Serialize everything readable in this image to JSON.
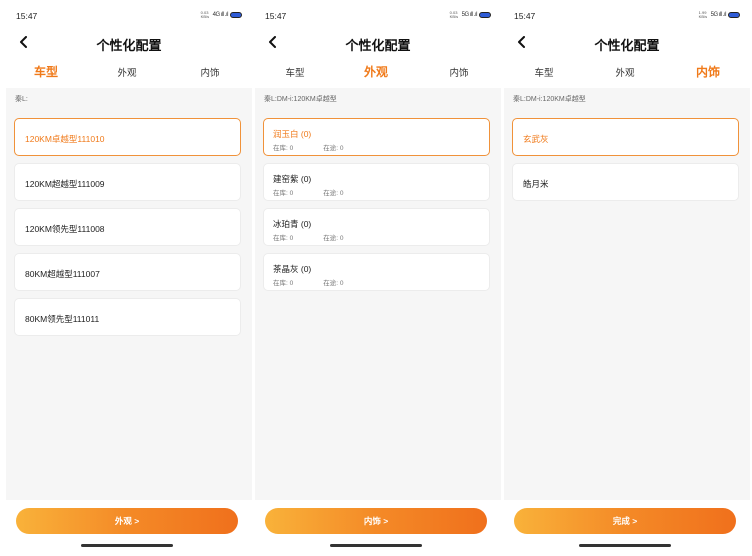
{
  "screens": [
    {
      "status_time": "15:47",
      "net_speed": "0.03 KB/s",
      "signal": "4G ıll .ıl",
      "title": "个性化配置",
      "tabs": [
        "车型",
        "外观",
        "内饰"
      ],
      "active_tab": 0,
      "model_line": "秦L:",
      "items": [
        {
          "label": "120KM卓越型111010",
          "selected": true
        },
        {
          "label": "120KM超越型111009",
          "selected": false
        },
        {
          "label": "120KM领先型111008",
          "selected": false
        },
        {
          "label": "80KM超越型111007",
          "selected": false
        },
        {
          "label": "80KM领先型111011",
          "selected": false
        }
      ],
      "cta": "外观 >"
    },
    {
      "status_time": "15:47",
      "net_speed": "0.03 KB/s",
      "signal": "5G ıll .ıl",
      "title": "个性化配置",
      "tabs": [
        "车型",
        "外观",
        "内饰"
      ],
      "active_tab": 1,
      "model_line": "秦L:DM-i:120KM卓越型",
      "colors": [
        {
          "name": "润玉白 (0)",
          "stock_label": "在库: 0",
          "transit_label": "在途: 0",
          "selected": true
        },
        {
          "name": "建窑紫 (0)",
          "stock_label": "在库: 0",
          "transit_label": "在途: 0",
          "selected": false
        },
        {
          "name": "冰珀青 (0)",
          "stock_label": "在库: 0",
          "transit_label": "在途: 0",
          "selected": false
        },
        {
          "name": "茶晶灰 (0)",
          "stock_label": "在库: 0",
          "transit_label": "在途: 0",
          "selected": false
        }
      ],
      "cta": "内饰 >"
    },
    {
      "status_time": "15:47",
      "net_speed": "1.99 KB/s",
      "signal": "5G ıll .ıl",
      "title": "个性化配置",
      "tabs": [
        "车型",
        "外观",
        "内饰"
      ],
      "active_tab": 2,
      "model_line": "秦L:DM-i:120KM卓越型",
      "interiors": [
        {
          "label": "玄武灰",
          "selected": true
        },
        {
          "label": "皓月米",
          "selected": false
        }
      ],
      "cta": "完成 >"
    }
  ],
  "colors": {
    "accent": "#f07a1a",
    "accent_border": "#f0923a",
    "background": "#f6f6f6",
    "card": "#ffffff",
    "battery": "#2f5cd6"
  }
}
